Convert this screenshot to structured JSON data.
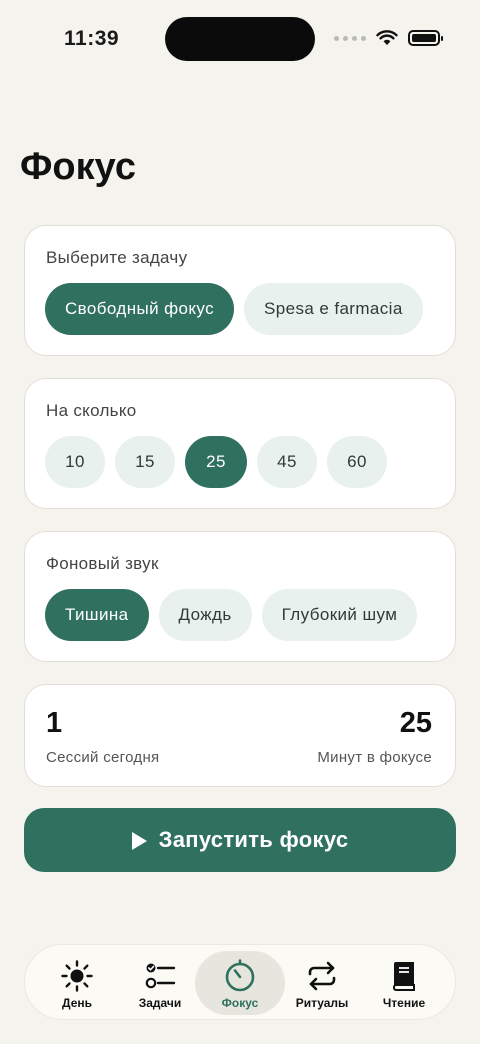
{
  "status_bar": {
    "time": "11:39"
  },
  "page": {
    "title": "Фокус"
  },
  "task_card": {
    "label": "Выберите задачу",
    "chips": [
      {
        "label": "Свободный фокус",
        "active": true
      },
      {
        "label": "Spesa e farmacia",
        "active": false
      }
    ]
  },
  "duration_card": {
    "label": "На сколько",
    "chips": [
      {
        "label": "10",
        "active": false
      },
      {
        "label": "15",
        "active": false
      },
      {
        "label": "25",
        "active": true
      },
      {
        "label": "45",
        "active": false
      },
      {
        "label": "60",
        "active": false
      }
    ]
  },
  "sound_card": {
    "label": "Фоновый звук",
    "chips": [
      {
        "label": "Тишина",
        "active": true
      },
      {
        "label": "Дождь",
        "active": false
      },
      {
        "label": "Глубокий шум",
        "active": false
      }
    ]
  },
  "stats": {
    "sessions_value": "1",
    "sessions_label": "Сессий сегодня",
    "minutes_value": "25",
    "minutes_label": "Минут в фокусе"
  },
  "start_button": {
    "label": "Запустить фокус",
    "icon": "play-icon"
  },
  "tab_bar": {
    "items": [
      {
        "label": "День",
        "icon": "sun-icon",
        "active": false
      },
      {
        "label": "Задачи",
        "icon": "checklist-icon",
        "active": false
      },
      {
        "label": "Фокус",
        "icon": "timer-icon",
        "active": true
      },
      {
        "label": "Ритуалы",
        "icon": "repeat-icon",
        "active": false
      },
      {
        "label": "Чтение",
        "icon": "book-icon",
        "active": false
      }
    ]
  },
  "colors": {
    "accent": "#30705f",
    "chip_bg": "#e8f1ee",
    "background": "#f5f3ee",
    "card": "#ffffff"
  }
}
